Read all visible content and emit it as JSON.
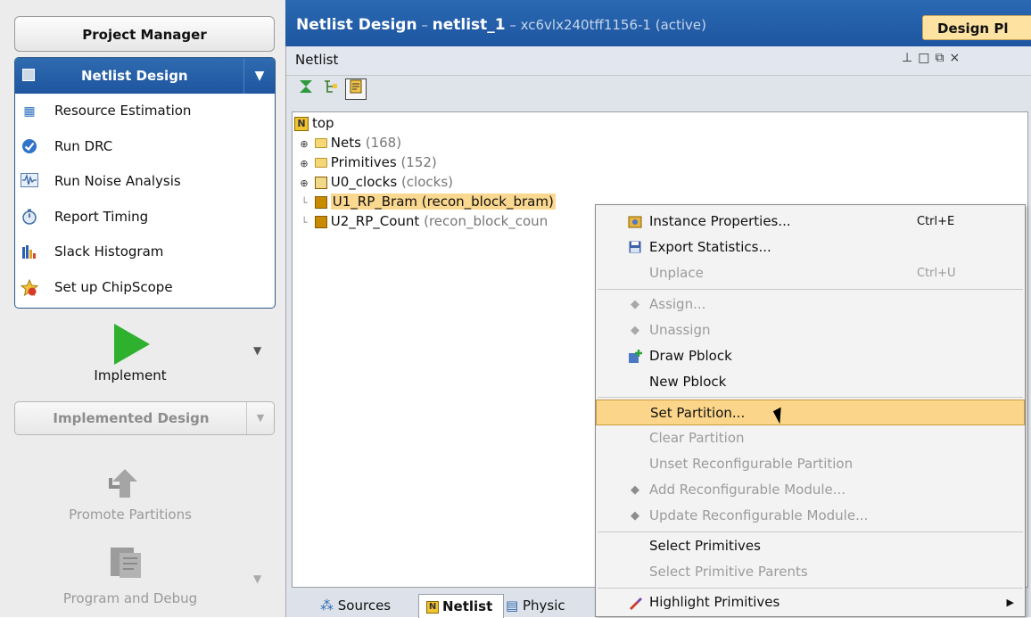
{
  "flow": {
    "project_manager": "Project Manager",
    "netlist_design": "Netlist Design",
    "items": [
      {
        "label": "Resource Estimation",
        "icon": "resource-estimation-icon"
      },
      {
        "label": "Run DRC",
        "icon": "run-drc-icon"
      },
      {
        "label": "Run Noise Analysis",
        "icon": "noise-analysis-icon"
      },
      {
        "label": "Report Timing",
        "icon": "stopwatch-icon"
      },
      {
        "label": "Slack Histogram",
        "icon": "histogram-icon"
      },
      {
        "label": "Set up ChipScope",
        "icon": "chipscope-icon"
      }
    ],
    "implement": "Implement",
    "implemented_design": "Implemented Design",
    "promote_partitions": "Promote Partitions",
    "program_and_debug": "Program and Debug"
  },
  "header": {
    "title_bold": "Netlist Design",
    "title_sep": " – ",
    "netlist_name": "netlist_1",
    "rest": " – xc6vlx240tff1156-1 (active)",
    "design_planner_button": "Design Pl"
  },
  "netlist": {
    "panel_title": "Netlist",
    "tree": {
      "root": "top",
      "nets_label": "Nets",
      "nets_count": "(168)",
      "primitives_label": "Primitives",
      "primitives_count": "(152)",
      "u0_label": "U0_clocks",
      "u0_type": "(clocks)",
      "u1_label": "U1_RP_Bram (recon_block_bram)",
      "u2_label": "U2_RP_Count",
      "u2_type": "(recon_block_coun"
    },
    "tabs": {
      "sources": "Sources",
      "netlist": "Netlist",
      "physical": "Physic"
    }
  },
  "context_menu": {
    "items": [
      {
        "label": "Instance Properties...",
        "shortcut": "Ctrl+E",
        "enabled": true
      },
      {
        "label": "Export Statistics...",
        "shortcut": "",
        "enabled": true
      },
      {
        "label": "Unplace",
        "shortcut": "Ctrl+U",
        "enabled": false
      },
      {
        "label": "Assign...",
        "enabled": false
      },
      {
        "label": "Unassign",
        "enabled": false
      },
      {
        "label": "Draw Pblock",
        "enabled": true
      },
      {
        "label": "New Pblock",
        "enabled": true
      },
      {
        "label": "Set Partition...",
        "enabled": true,
        "highlighted": true
      },
      {
        "label": "Clear Partition",
        "enabled": false
      },
      {
        "label": "Unset Reconfigurable Partition",
        "enabled": false
      },
      {
        "label": "Add Reconfigurable Module...",
        "enabled": false
      },
      {
        "label": "Update Reconfigurable Module...",
        "enabled": false
      },
      {
        "label": "Select Primitives",
        "enabled": true
      },
      {
        "label": "Select Primitive Parents",
        "enabled": false
      },
      {
        "label": "Highlight Primitives",
        "enabled": true,
        "submenu": true
      }
    ]
  },
  "colors": {
    "accent_blue": "#1e56a0",
    "highlight": "#fbd68a",
    "run_green": "#2fb02f"
  }
}
